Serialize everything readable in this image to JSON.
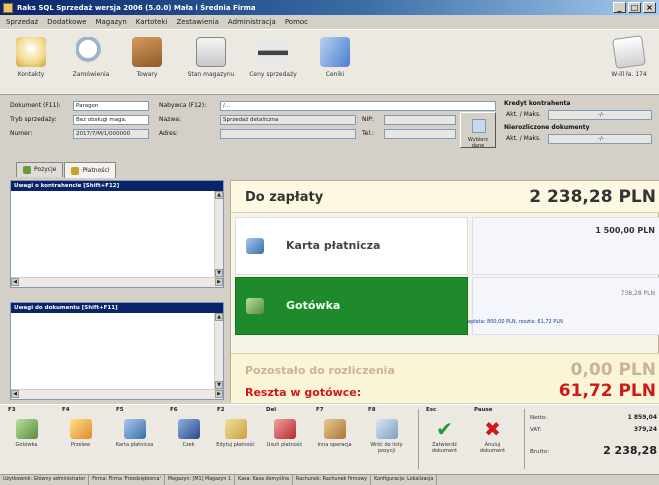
{
  "window": {
    "title": "Raks SQL Sprzedaż wersja 2006 (5.0.0) Mała i Średnia Firma",
    "controls": [
      "_",
      "□",
      "×"
    ]
  },
  "menu": [
    "Sprzedaż",
    "Dodatkowe",
    "Magazyn",
    "Kartoteki",
    "Zestawienia",
    "Administracja",
    "Pomoc"
  ],
  "toolbar": [
    {
      "label": "Kontakty",
      "icon": "question-icon"
    },
    {
      "label": "Zamówienia",
      "icon": "search-icon"
    },
    {
      "label": "Towary",
      "icon": "goods-icon"
    },
    {
      "label": "Stan magazynu",
      "icon": "stock-icon"
    },
    {
      "label": "Ceny sprzedaży",
      "icon": "price-icon"
    },
    {
      "label": "Ceniki",
      "icon": "cash-icon"
    }
  ],
  "toolbar_right": {
    "label": "W-ill ła. 174",
    "icon": "print-icon"
  },
  "doc": {
    "dokument_label": "Dokument (F11):",
    "dokument_value": "Paragon",
    "tryb_label": "Tryb sprzedaży:",
    "tryb_value": "Bez obsługi maga.",
    "numer_label": "Numer:",
    "numer_value": "2017/7/M/1/000000",
    "nabywca_label": "Nabywca (F12):",
    "nabywca_value": "/…",
    "nazwa_label": "Nazwa:",
    "nazwa_value": "Sprzedaż detaliczna",
    "adres_label": "Adres:",
    "adres_value": "",
    "nip_label": "NIP:",
    "tel_label": "Tel.:",
    "choose_btn": "Wybierz dane"
  },
  "credit": {
    "title": "Kredyt kontrahenta",
    "row1_label": "Akt. / Maks.",
    "row1_value": "-/-",
    "title2": "Nierozliczone dokumenty",
    "row2_label": "Akt. / Maks.",
    "row2_value": "-/-"
  },
  "tabs": [
    "Pozycje",
    "Płatności"
  ],
  "left_panels": {
    "uwagi_kontrahent": "Uwagi o kontrahencie [Shift+F12]",
    "uwagi_dokument": "Uwagi do dokumentu [Shift+F11]"
  },
  "payment": {
    "do_zaplaty_label": "Do zapłaty",
    "do_zaplaty_value": "2 238,28 PLN",
    "karta_label": "Karta płatnicza",
    "karta_value": "1 500,00 PLN",
    "gotowka_label": "Gotówka",
    "gotowka_value": "738,28 PLN",
    "gotowka_note": "wpłata: 800,00 PLN, reszta: 61,72 PLN",
    "pozostalo_label": "Pozostało do rozliczenia",
    "pozostalo_value": "0,00 PLN",
    "reszta_label": "Reszta w gotówce:",
    "reszta_value": "61,72 PLN"
  },
  "fkeys": [
    {
      "key": "F3",
      "label": "Gotówka",
      "icon": "money-icon"
    },
    {
      "key": "F4",
      "label": "Przelew",
      "icon": "transfer-icon"
    },
    {
      "key": "F5",
      "label": "Karta płatnicza",
      "icon": "card-icon"
    },
    {
      "key": "F6",
      "label": "Czek",
      "icon": "check-icon"
    },
    {
      "key": "F2",
      "label": "Edytuj płatność",
      "icon": "edit-icon"
    },
    {
      "key": "Del",
      "label": "Usuń płatność",
      "icon": "delete-icon"
    },
    {
      "key": "F7",
      "label": "Inna operacja",
      "icon": "box-icon"
    },
    {
      "key": "F8",
      "label": "Wróć do listy pozycji",
      "icon": "list-icon"
    },
    {
      "key": "Esc",
      "label": "Zatwierdź dokument",
      "icon": "confirm-icon"
    },
    {
      "key": "Pause",
      "label": "Anuluj dokument",
      "icon": "cancel-icon"
    }
  ],
  "totals": {
    "netto_label": "Netto:",
    "netto_value": "1 859,04",
    "vat_label": "VAT:",
    "vat_value": "379,24",
    "brutto_label": "Brutto:",
    "brutto_value": "2 238,28"
  },
  "status": [
    "Użytkownik: Główny administrator",
    "Firma: Firma 'Przedsiębiorca'",
    "Magazyn: [M1] Magazyn 1",
    "Kasa: Kasa domyślna",
    "Rachunek: Rachunek firmowy",
    "Konfiguracje: Lokalizacja"
  ]
}
